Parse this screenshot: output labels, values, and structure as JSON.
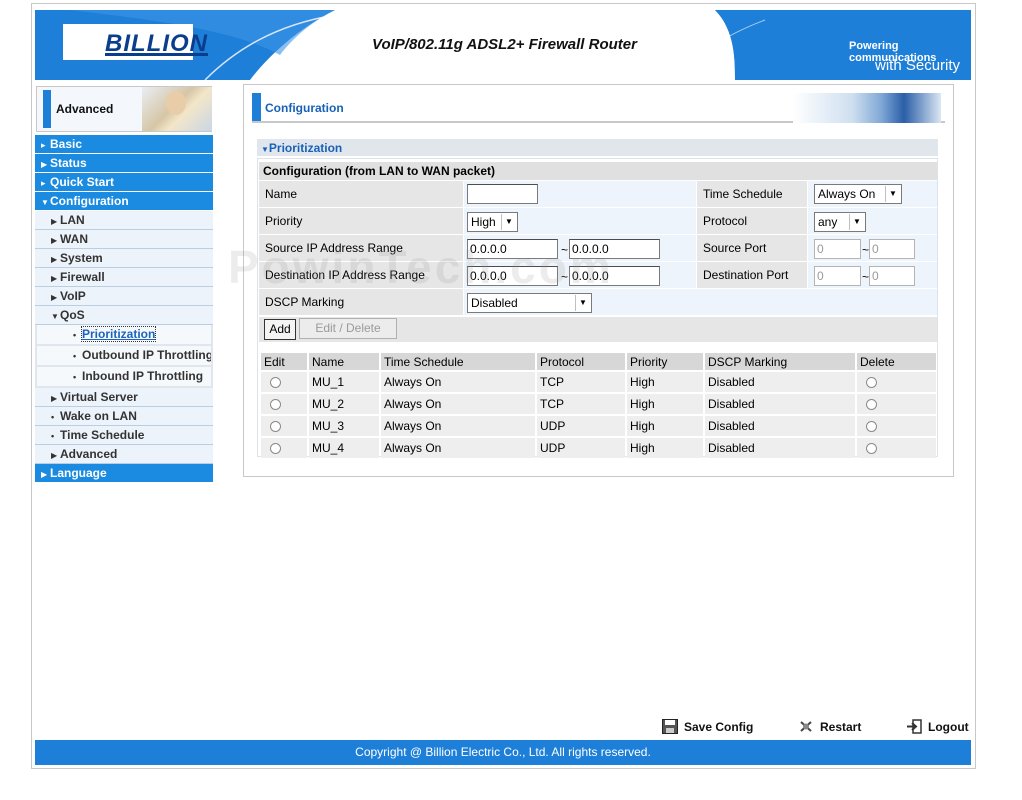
{
  "header": {
    "logo": "BILLION",
    "title": "VoIP/802.11g ADSL2+ Firewall Router",
    "tagline_line1": "Powering communications",
    "tagline_line2": "with Security"
  },
  "sidebar": {
    "mode_label": "Advanced",
    "items": [
      {
        "label": "Basic",
        "level": "top"
      },
      {
        "label": "Status",
        "level": "top"
      },
      {
        "label": "Quick Start",
        "level": "top"
      },
      {
        "label": "Configuration",
        "level": "top",
        "expanded": true
      },
      {
        "label": "LAN",
        "level": "sub"
      },
      {
        "label": "WAN",
        "level": "sub"
      },
      {
        "label": "System",
        "level": "sub"
      },
      {
        "label": "Firewall",
        "level": "sub"
      },
      {
        "label": "VoIP",
        "level": "sub"
      },
      {
        "label": "QoS",
        "level": "sub",
        "expanded": true
      },
      {
        "label": "Prioritization",
        "level": "subsub",
        "active": true
      },
      {
        "label": "Outbound IP Throttling",
        "level": "subsub"
      },
      {
        "label": "Inbound IP Throttling",
        "level": "subsub"
      },
      {
        "label": "Virtual Server",
        "level": "sub"
      },
      {
        "label": "Wake on LAN",
        "level": "sub"
      },
      {
        "label": "Time Schedule",
        "level": "sub"
      },
      {
        "label": "Advanced",
        "level": "sub"
      },
      {
        "label": "Language",
        "level": "top"
      }
    ]
  },
  "content": {
    "page_title": "Configuration",
    "section_title": "Prioritization",
    "form_heading": "Configuration (from LAN to WAN packet)",
    "form": {
      "name_label": "Name",
      "name_value": "",
      "time_schedule_label": "Time Schedule",
      "time_schedule_value": "Always On",
      "priority_label": "Priority",
      "priority_value": "High",
      "protocol_label": "Protocol",
      "protocol_value": "any",
      "src_ip_label": "Source IP Address Range",
      "src_ip_start": "0.0.0.0",
      "src_ip_end": "0.0.0.0",
      "src_port_label": "Source Port",
      "src_port_start": "0",
      "src_port_end": "0",
      "dst_ip_label": "Destination IP Address Range",
      "dst_ip_start": "0.0.0.0",
      "dst_ip_end": "0.0.0.0",
      "dst_port_label": "Destination Port",
      "dst_port_start": "0",
      "dst_port_end": "0",
      "dscp_label": "DSCP Marking",
      "dscp_value": "Disabled",
      "range_sep": "~"
    },
    "buttons": {
      "add": "Add",
      "edit_delete": "Edit / Delete"
    },
    "table": {
      "columns": [
        "Edit",
        "Name",
        "Time Schedule",
        "Protocol",
        "Priority",
        "DSCP Marking",
        "Delete"
      ],
      "rows": [
        {
          "name": "MU_1",
          "schedule": "Always On",
          "protocol": "TCP",
          "priority": "High",
          "dscp": "Disabled"
        },
        {
          "name": "MU_2",
          "schedule": "Always On",
          "protocol": "TCP",
          "priority": "High",
          "dscp": "Disabled"
        },
        {
          "name": "MU_3",
          "schedule": "Always On",
          "protocol": "UDP",
          "priority": "High",
          "dscp": "Disabled"
        },
        {
          "name": "MU_4",
          "schedule": "Always On",
          "protocol": "UDP",
          "priority": "High",
          "dscp": "Disabled"
        }
      ]
    }
  },
  "watermark": "PowinTech.com",
  "footer": {
    "save_config": "Save Config",
    "restart": "Restart",
    "logout": "Logout",
    "copyright": "Copyright @ Billion Electric Co., Ltd. All rights reserved."
  },
  "colors": {
    "brand_blue": "#1e7fd8",
    "menu_blue": "#1a8be0",
    "title_blue": "#1762b8"
  }
}
